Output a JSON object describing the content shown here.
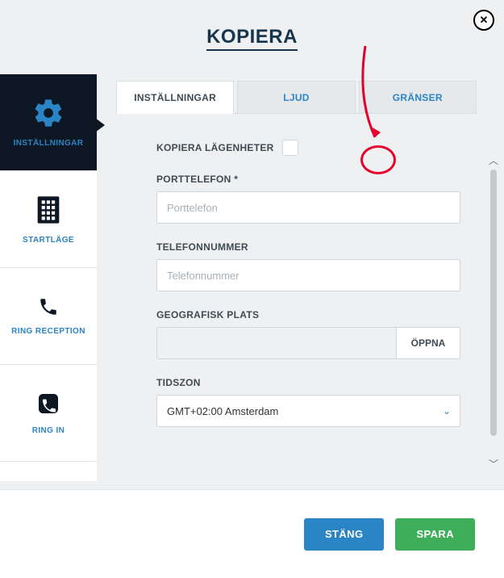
{
  "modal": {
    "title": "KOPIERA"
  },
  "sidebar": {
    "items": [
      {
        "label": "INSTÄLLNINGAR"
      },
      {
        "label": "STARTLÄGE"
      },
      {
        "label": "RING RECEPTION"
      },
      {
        "label": "RING IN"
      }
    ]
  },
  "tabs": [
    {
      "label": "INSTÄLLNINGAR"
    },
    {
      "label": "LJUD"
    },
    {
      "label": "GRÄNSER"
    }
  ],
  "form": {
    "copy_apartments_label": "KOPIERA LÄGENHETER",
    "porttelefon_label": "PORTTELEFON *",
    "porttelefon_placeholder": "Porttelefon",
    "telefon_label": "TELEFONNUMMER",
    "telefon_placeholder": "Telefonnummer",
    "geografisk_label": "GEOGRAFISK PLATS",
    "open_button": "ÖPPNA",
    "tidszon_label": "TIDSZON",
    "tidszon_value": "GMT+02:00 Amsterdam"
  },
  "footer": {
    "close": "STÄNG",
    "save": "SPARA"
  }
}
